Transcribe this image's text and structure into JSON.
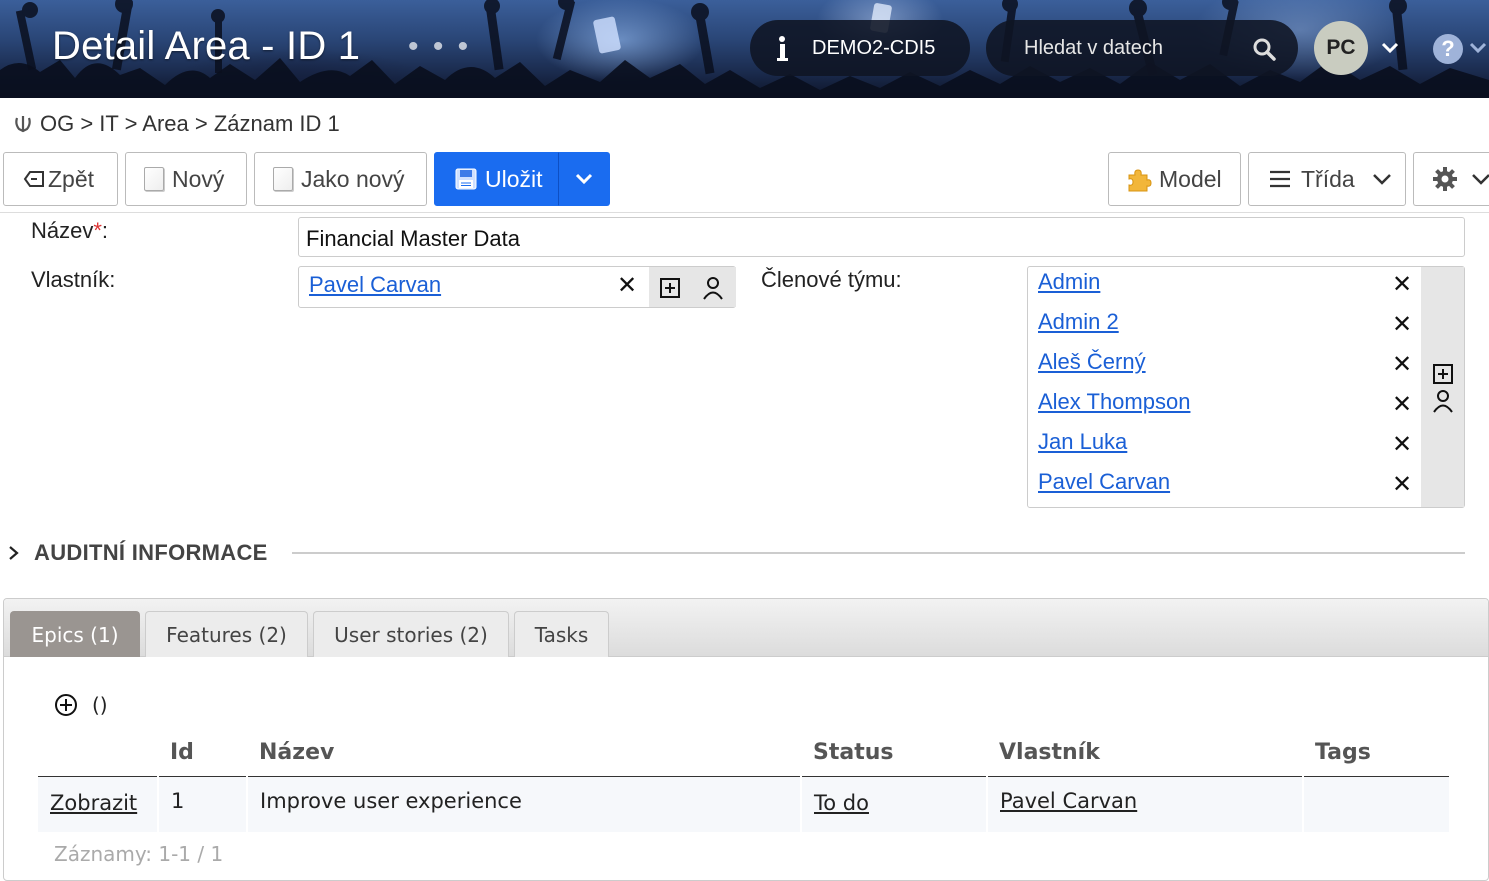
{
  "header": {
    "title": "Detail Area - ID 1",
    "title_more": "...",
    "database": "DEMO2-CDI5",
    "search_placeholder": "Hledat v datech",
    "user_initials": "PC",
    "help": "?"
  },
  "breadcrumb": "OG > IT > Area > Záznam ID 1",
  "toolbar": {
    "back": "Zpět",
    "new": "Nový",
    "copy": "Jako nový",
    "save": "Uložit",
    "model": "Model",
    "class": "Třída"
  },
  "form": {
    "name_label": "Název",
    "required_mark": "*",
    "colon": ":",
    "name_value": "Financial Master Data",
    "owner_label": "Vlastník:",
    "owner_value": "Pavel Carvan",
    "team_label": "Členové týmu:",
    "team_members": [
      "Admin",
      "Admin 2",
      "Aleš Černý",
      "Alex Thompson",
      "Jan Luka",
      "Pavel Carvan"
    ]
  },
  "audit": {
    "label": "AUDITNÍ INFORMACE"
  },
  "tabs": [
    "Epics (1)",
    "Features (2)",
    "User stories (2)",
    "Tasks"
  ],
  "active_tab": "Epics (1)",
  "grid": {
    "add_parens": "()",
    "columns": [
      "",
      "Id",
      "Název",
      "Status",
      "Vlastník",
      "Tags"
    ],
    "rows": [
      {
        "action": "Zobrazit",
        "id": "1",
        "name": "Improve user experience",
        "status": "To do",
        "owner": "Pavel Carvan",
        "tags": ""
      }
    ],
    "records": "Záznamy: 1-1 / 1"
  },
  "colors": {
    "primary": "#1a6cf0",
    "link": "#1a5fd6",
    "active_tab": "#9a9591",
    "required": "#dd3333"
  }
}
